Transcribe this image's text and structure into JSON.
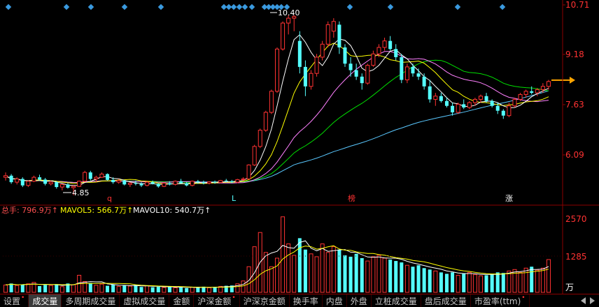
{
  "chart_data": {
    "type": "candlestick",
    "price_axis": {
      "labels": [
        "10.71",
        "9.18",
        "7.63",
        "6.09"
      ],
      "values": [
        10.71,
        9.18,
        7.63,
        6.09
      ]
    },
    "annotations": {
      "high_label": "10.40",
      "low_label": "4.85"
    },
    "event_markers": [
      "q",
      "L",
      "榜",
      "涨"
    ],
    "volume_header": {
      "total": "总手: 796.9万↑",
      "ma5": "MAVOL5: 566.7万↑",
      "ma10": "MAVOL10: 540.7万↑"
    },
    "volume_axis": {
      "labels": [
        "2570",
        "1285"
      ],
      "unit": "万"
    },
    "colors": {
      "up": "#ff3232",
      "down": "#54ffff",
      "ma5": "#ffffff",
      "ma10": "#ffff00",
      "ma20": "#ff80ff",
      "ma30": "#00e000",
      "ma60": "#5ac8ff",
      "axis": "#8b0000",
      "diamond": "#3a9adf",
      "arrow": "#ffa500"
    },
    "candles": [
      [
        5.4,
        5.55,
        5.3,
        5.45
      ],
      [
        5.45,
        5.5,
        5.2,
        5.25
      ],
      [
        5.25,
        5.4,
        5.18,
        5.35
      ],
      [
        5.35,
        5.4,
        5.1,
        5.15
      ],
      [
        5.15,
        5.3,
        5.1,
        5.28
      ],
      [
        5.28,
        5.45,
        5.25,
        5.4
      ],
      [
        5.4,
        5.48,
        5.3,
        5.33
      ],
      [
        5.33,
        5.38,
        5.15,
        5.2
      ],
      [
        5.2,
        5.3,
        5.15,
        5.25
      ],
      [
        5.25,
        5.28,
        5.05,
        5.1
      ],
      [
        5.1,
        5.2,
        5.0,
        5.18
      ],
      [
        5.18,
        5.22,
        5.05,
        5.08
      ],
      [
        5.08,
        5.15,
        4.85,
        5.12
      ],
      [
        5.12,
        5.3,
        5.1,
        5.28
      ],
      [
        5.28,
        5.6,
        5.25,
        5.55
      ],
      [
        5.55,
        5.6,
        5.3,
        5.35
      ],
      [
        5.35,
        5.45,
        5.25,
        5.4
      ],
      [
        5.4,
        5.55,
        5.38,
        5.5
      ],
      [
        5.5,
        5.52,
        5.3,
        5.32
      ],
      [
        5.32,
        5.4,
        5.2,
        5.25
      ],
      [
        5.25,
        5.35,
        5.2,
        5.3
      ],
      [
        5.3,
        5.32,
        5.15,
        5.18
      ],
      [
        5.18,
        5.25,
        5.1,
        5.22
      ],
      [
        5.22,
        5.3,
        5.15,
        5.2
      ],
      [
        5.2,
        5.25,
        5.1,
        5.15
      ],
      [
        5.15,
        5.28,
        5.12,
        5.25
      ],
      [
        5.25,
        5.3,
        5.18,
        5.2
      ],
      [
        5.2,
        5.22,
        5.08,
        5.12
      ],
      [
        5.12,
        5.25,
        5.1,
        5.22
      ],
      [
        5.22,
        5.28,
        5.15,
        5.18
      ],
      [
        5.18,
        5.3,
        5.15,
        5.28
      ],
      [
        5.28,
        5.35,
        5.2,
        5.22
      ],
      [
        5.22,
        5.25,
        5.12,
        5.15
      ],
      [
        5.15,
        5.3,
        5.12,
        5.28
      ],
      [
        5.28,
        5.32,
        5.2,
        5.25
      ],
      [
        5.25,
        5.3,
        5.18,
        5.22
      ],
      [
        5.22,
        5.28,
        5.18,
        5.26
      ],
      [
        5.26,
        5.3,
        5.2,
        5.24
      ],
      [
        5.24,
        5.32,
        5.22,
        5.3
      ],
      [
        5.3,
        5.35,
        5.25,
        5.28
      ],
      [
        5.28,
        5.32,
        5.22,
        5.25
      ],
      [
        5.25,
        5.35,
        5.22,
        5.33
      ],
      [
        5.33,
        5.4,
        5.28,
        5.35
      ],
      [
        5.35,
        5.8,
        5.33,
        5.78
      ],
      [
        5.78,
        6.4,
        5.75,
        6.35
      ],
      [
        6.35,
        6.9,
        6.3,
        6.85
      ],
      [
        6.85,
        7.45,
        6.8,
        7.4
      ],
      [
        7.4,
        8.1,
        7.35,
        8.05
      ],
      [
        8.05,
        9.4,
        8.0,
        9.35
      ],
      [
        9.35,
        10.2,
        9.3,
        10.15
      ],
      [
        10.15,
        10.4,
        9.8,
        10.3
      ],
      [
        10.3,
        10.4,
        9.9,
        10.35
      ],
      [
        9.6,
        9.9,
        8.6,
        8.8
      ],
      [
        8.8,
        9.0,
        7.9,
        8.2
      ],
      [
        8.2,
        8.7,
        8.1,
        8.6
      ],
      [
        8.6,
        9.2,
        8.5,
        9.1
      ],
      [
        9.1,
        9.6,
        9.0,
        9.5
      ],
      [
        9.5,
        10.2,
        9.4,
        10.1
      ],
      [
        9.9,
        10.3,
        9.7,
        10.2
      ],
      [
        10.1,
        10.2,
        9.2,
        9.4
      ],
      [
        9.4,
        9.5,
        8.8,
        8.9
      ],
      [
        8.9,
        9.1,
        8.5,
        8.7
      ],
      [
        8.7,
        8.9,
        8.4,
        8.5
      ],
      [
        8.5,
        8.6,
        8.1,
        8.3
      ],
      [
        8.3,
        8.9,
        8.25,
        8.85
      ],
      [
        8.85,
        9.3,
        8.8,
        9.2
      ],
      [
        9.2,
        9.5,
        9.1,
        9.4
      ],
      [
        9.4,
        9.7,
        9.3,
        9.6
      ],
      [
        9.6,
        9.75,
        9.3,
        9.35
      ],
      [
        9.35,
        9.5,
        9.0,
        9.1
      ],
      [
        9.1,
        9.2,
        8.3,
        8.4
      ],
      [
        8.4,
        8.9,
        8.3,
        8.8
      ],
      [
        8.8,
        8.9,
        8.5,
        8.6
      ],
      [
        8.6,
        8.75,
        8.4,
        8.5
      ],
      [
        8.5,
        8.6,
        8.1,
        8.2
      ],
      [
        8.2,
        8.4,
        7.7,
        7.8
      ],
      [
        7.8,
        8.0,
        7.6,
        7.9
      ],
      [
        7.9,
        8.0,
        7.7,
        7.75
      ],
      [
        7.75,
        7.85,
        7.55,
        7.6
      ],
      [
        7.6,
        7.7,
        7.3,
        7.4
      ],
      [
        7.4,
        7.7,
        7.35,
        7.65
      ],
      [
        7.65,
        7.8,
        7.5,
        7.55
      ],
      [
        7.55,
        7.75,
        7.5,
        7.7
      ],
      [
        7.7,
        7.85,
        7.6,
        7.8
      ],
      [
        7.8,
        7.95,
        7.7,
        7.9
      ],
      [
        7.9,
        8.0,
        7.7,
        7.75
      ],
      [
        7.75,
        7.8,
        7.55,
        7.6
      ],
      [
        7.6,
        7.7,
        7.35,
        7.45
      ],
      [
        7.45,
        7.5,
        7.2,
        7.3
      ],
      [
        7.3,
        7.7,
        7.25,
        7.6
      ],
      [
        7.6,
        7.85,
        7.55,
        7.8
      ],
      [
        7.8,
        8.0,
        7.75,
        7.95
      ],
      [
        7.95,
        8.1,
        7.85,
        8.05
      ],
      [
        8.05,
        8.2,
        7.95,
        8.0
      ],
      [
        8.0,
        8.15,
        7.9,
        8.1
      ],
      [
        8.1,
        8.3,
        8.0,
        8.2
      ],
      [
        8.2,
        8.4,
        8.1,
        8.35
      ]
    ],
    "volume": [
      260,
      310,
      240,
      280,
      300,
      350,
      220,
      260,
      240,
      290,
      200,
      310,
      270,
      600,
      380,
      330,
      250,
      290,
      230,
      270,
      210,
      240,
      220,
      260,
      190,
      230,
      180,
      200,
      170,
      210,
      160,
      190,
      150,
      180,
      170,
      200,
      160,
      190,
      210,
      230,
      240,
      300,
      400,
      900,
      1600,
      2100,
      1400,
      900,
      1200,
      2650,
      1700,
      1300,
      1900,
      1500,
      1350,
      1250,
      1700,
      1400,
      1600,
      1500,
      1300,
      1250,
      1350,
      1200,
      1100,
      1250,
      1300,
      1200,
      1150,
      1100,
      1050,
      950,
      900,
      950,
      850,
      800,
      750,
      700,
      650,
      700,
      600,
      650,
      700,
      620,
      580,
      600,
      650,
      700,
      680,
      750,
      800,
      700,
      850,
      900,
      780,
      850,
      1150
    ]
  },
  "tabs": [
    {
      "label": "设置",
      "dot": true
    },
    {
      "label": "成交量",
      "dot": false,
      "active": true
    },
    {
      "label": "多周期成交量",
      "dot": false
    },
    {
      "label": "虚拟成交量",
      "dot": false
    },
    {
      "label": "金额",
      "dot": false
    },
    {
      "label": "沪深金额",
      "dot": true
    },
    {
      "label": "沪深京金额",
      "dot": false
    },
    {
      "label": "换手率",
      "dot": false
    },
    {
      "label": "内盘",
      "dot": false
    },
    {
      "label": "外盘",
      "dot": false
    },
    {
      "label": "立桩成交量",
      "dot": false
    },
    {
      "label": "盘后成交量",
      "dot": false
    },
    {
      "label": "市盈率(ttm)",
      "dot": true
    }
  ]
}
